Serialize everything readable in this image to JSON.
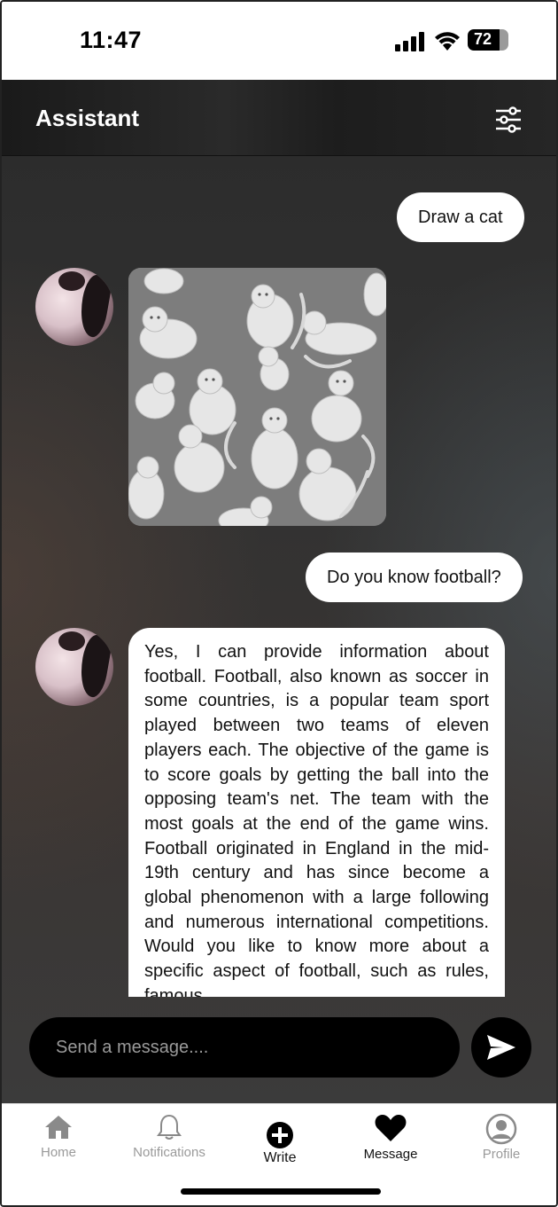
{
  "status_bar": {
    "time": "11:47",
    "battery": "72"
  },
  "header": {
    "title": "Assistant",
    "settings_icon": "sliders-icon"
  },
  "messages": [
    {
      "role": "user",
      "text": "Draw a cat"
    },
    {
      "role": "assistant",
      "type": "image"
    },
    {
      "role": "user",
      "text": "Do you know football?"
    },
    {
      "role": "assistant",
      "text": " Yes, I can provide information about football. Football, also known as soccer in some countries, is a popular team sport played between two teams of eleven players each. The objective of the game is to score goals by getting the ball into the opposing team's net. The team with the most goals at the end of the game wins. Football originated in England in the mid-19th century and has since become a global phenomenon with a large following and numerous international competitions. Would you like to know more about a specific aspect of football, such as rules, famous"
    }
  ],
  "composer": {
    "placeholder": "Send a message...."
  },
  "nav": {
    "items": [
      {
        "label": "Home",
        "icon": "home-icon"
      },
      {
        "label": "Notifications",
        "icon": "bell-icon"
      },
      {
        "label": "Write",
        "icon": "plus-circle-icon"
      },
      {
        "label": "Message",
        "icon": "heart-icon"
      },
      {
        "label": "Profile",
        "icon": "user-circle-icon"
      }
    ]
  },
  "colors": {
    "background": "#333333",
    "bubble": "#ffffff",
    "composer": "#000000",
    "inactive_nav": "#9a9a9a"
  }
}
